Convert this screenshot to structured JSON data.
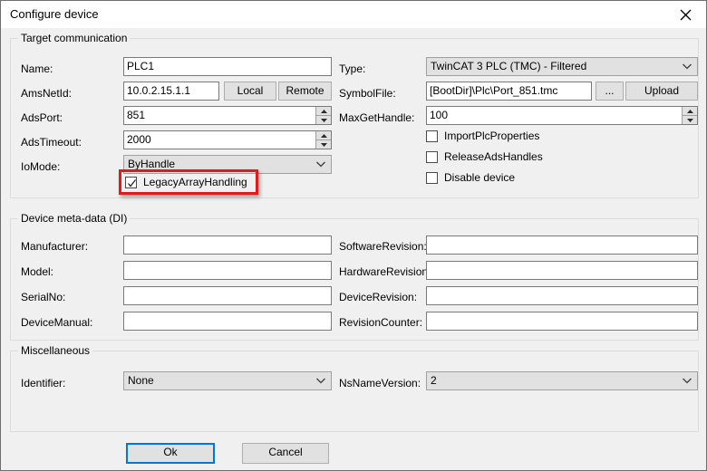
{
  "window": {
    "title": "Configure device",
    "close_icon": "close-icon"
  },
  "groups": {
    "target_communication": {
      "label": "Target communication"
    },
    "device_metadata": {
      "label": "Device meta-data (DI)"
    },
    "miscellaneous": {
      "label": "Miscellaneous"
    }
  },
  "target_communication": {
    "name": {
      "label": "Name:",
      "value": "PLC1"
    },
    "ams_net_id": {
      "label": "AmsNetId:",
      "value": "10.0.2.15.1.1"
    },
    "local_button": "Local",
    "remote_button": "Remote",
    "ads_port": {
      "label": "AdsPort:",
      "value": "851"
    },
    "ads_timeout": {
      "label": "AdsTimeout:",
      "value": "2000"
    },
    "io_mode": {
      "label": "IoMode:",
      "value": "ByHandle"
    },
    "legacy_array_handling": {
      "label": "LegacyArrayHandling",
      "checked": true
    },
    "type": {
      "label": "Type:",
      "value": "TwinCAT 3 PLC (TMC) - Filtered"
    },
    "symbol_file": {
      "label": "SymbolFile:",
      "value": "[BootDir]\\Plc\\Port_851.tmc"
    },
    "browse_button": "...",
    "upload_button": "Upload",
    "max_get_handle": {
      "label": "MaxGetHandle:",
      "value": "100"
    },
    "import_plc_properties": {
      "label": "ImportPlcProperties",
      "checked": false
    },
    "release_ads_handles": {
      "label": "ReleaseAdsHandles",
      "checked": false
    },
    "disable_device": {
      "label": "Disable device",
      "checked": false
    }
  },
  "device_metadata": {
    "manufacturer": {
      "label": "Manufacturer:",
      "value": ""
    },
    "model": {
      "label": "Model:",
      "value": ""
    },
    "serial_no": {
      "label": "SerialNo:",
      "value": ""
    },
    "device_manual": {
      "label": "DeviceManual:",
      "value": ""
    },
    "software_revision": {
      "label": "SoftwareRevision:",
      "value": ""
    },
    "hardware_revision": {
      "label": "HardwareRevision:",
      "value": ""
    },
    "device_revision": {
      "label": "DeviceRevision:",
      "value": ""
    },
    "revision_counter": {
      "label": "RevisionCounter:",
      "value": ""
    }
  },
  "miscellaneous": {
    "identifier": {
      "label": "Identifier:",
      "value": "None"
    },
    "ns_name_version": {
      "label": "NsNameVersion:",
      "value": "2"
    }
  },
  "footer": {
    "ok_button": "Ok",
    "cancel_button": "Cancel"
  },
  "annotation": {
    "color": "#e01b1b",
    "target": "legacy-array-handling-checkbox"
  }
}
